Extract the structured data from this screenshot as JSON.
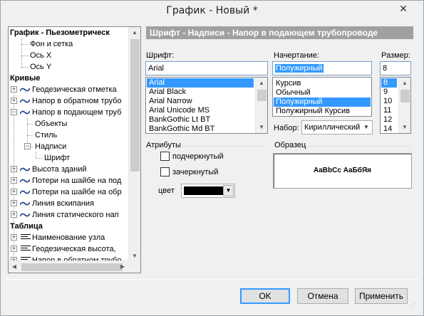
{
  "window": {
    "title": "График - Новый *",
    "close_glyph": "✕"
  },
  "tree": {
    "items": [
      {
        "label": "График - Пьезометрическ",
        "level": "root",
        "bold": true
      },
      {
        "label": "Фон и сетка"
      },
      {
        "label": "Ось X"
      },
      {
        "label": "Ось Y"
      },
      {
        "label": "Кривые",
        "bold": true
      },
      {
        "label": "Геодезическая отметка"
      },
      {
        "label": "Напор в обратном трубо"
      },
      {
        "label": "Напор в подающем труб"
      },
      {
        "label": "Объекты"
      },
      {
        "label": "Стиль"
      },
      {
        "label": "Надписи"
      },
      {
        "label": "Шрифт"
      },
      {
        "label": "Высота зданий"
      },
      {
        "label": "Потери на шайбе на под"
      },
      {
        "label": "Потери на шайбе на обр"
      },
      {
        "label": "Линия вскипания"
      },
      {
        "label": "Линия статического нап"
      },
      {
        "label": "Таблица",
        "bold": true
      },
      {
        "label": "Наименование узла"
      },
      {
        "label": "Геодезическая высота,"
      },
      {
        "label": "Напор в обратном трубо"
      }
    ]
  },
  "panel": {
    "header": "Шрифт - Надписи - Напор в подающем трубопроводе",
    "font": {
      "label": "Шрифт:",
      "value": "Arial",
      "options": [
        "Arial",
        "Arial Black",
        "Arial Narrow",
        "Arial Unicode MS",
        "BankGothic Lt BT",
        "BankGothic Md BT"
      ],
      "selected": "Arial"
    },
    "style": {
      "label": "Начертание:",
      "value": "Полужирный",
      "options": [
        "Курсив",
        "Обычный",
        "Полужирный",
        "Полужирный Курсив"
      ],
      "selected": "Полужирный"
    },
    "size": {
      "label": "Размер:",
      "value": "8",
      "options": [
        "8",
        "9",
        "10",
        "11",
        "12",
        "14"
      ],
      "selected": "8"
    },
    "charset": {
      "label": "Набор:",
      "value": "Кириллический"
    },
    "attributes": {
      "title": "Атрибуты",
      "underline": {
        "label": "подчеркнутый",
        "checked": false
      },
      "strikeout": {
        "label": "зачеркнутый",
        "checked": false
      },
      "color_label": "цвет",
      "color_value": "#000000"
    },
    "sample": {
      "title": "Образец",
      "text": "AaBbCc АаБбЯя"
    }
  },
  "buttons": {
    "ok": "OK",
    "cancel": "Отмена",
    "apply": "Применить"
  },
  "colors": {
    "header_bar": "#a0a0a0",
    "selection": "#3399ff",
    "accent": "#3399ff"
  }
}
